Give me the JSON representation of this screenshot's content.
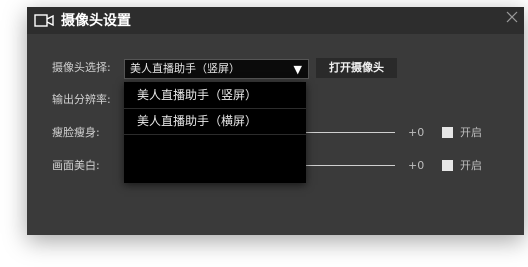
{
  "dialog": {
    "title": "摄像头设置",
    "title_icon": "video-camera-icon",
    "close_icon": "close-icon"
  },
  "camera": {
    "label": "摄像头选择:",
    "selected": "美人直播助手（竖屏）",
    "arrow": "▼",
    "open_button": "打开摄像头",
    "options": [
      "美人直播助手（竖屏）",
      "美人直播助手（横屏）"
    ]
  },
  "resolution": {
    "label": "输出分辨率:"
  },
  "slim_face": {
    "label": "瘦脸瘦身:",
    "value_text": "+0",
    "checkbox_label": "开启",
    "enabled": false
  },
  "whitening": {
    "label": "画面美白:",
    "value_text": "+0",
    "checkbox_label": "开启",
    "enabled": false
  },
  "colors": {
    "dialog_bg": "#3a3a3a",
    "titlebar_bg": "#2d2d2d",
    "dropdown_bg": "#000000"
  }
}
